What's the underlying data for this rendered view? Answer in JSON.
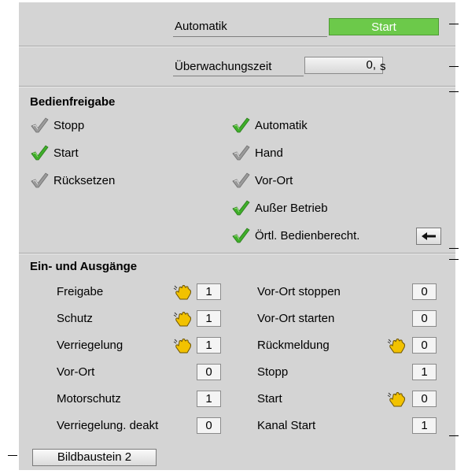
{
  "header": {
    "automatik_label": "Automatik",
    "start_button": "Start",
    "watch_label": "Überwachungszeit",
    "watch_value": "0,",
    "watch_unit": "s"
  },
  "permissions": {
    "title": "Bedienfreigabe",
    "left": [
      {
        "label": "Stopp",
        "enabled": false
      },
      {
        "label": "Start",
        "enabled": true
      },
      {
        "label": "Rücksetzen",
        "enabled": false
      }
    ],
    "right": [
      {
        "label": "Automatik",
        "enabled": true
      },
      {
        "label": "Hand",
        "enabled": false
      },
      {
        "label": "Vor-Ort",
        "enabled": false
      },
      {
        "label": "Außer Betrieb",
        "enabled": true
      },
      {
        "label": "Örtl. Bedienberecht.",
        "enabled": true
      }
    ]
  },
  "io": {
    "title": "Ein- und Ausgänge",
    "left": [
      {
        "label": "Freigabe",
        "value": "1",
        "hand": true
      },
      {
        "label": "Schutz",
        "value": "1",
        "hand": true
      },
      {
        "label": "Verriegelung",
        "value": "1",
        "hand": true
      },
      {
        "label": "Vor-Ort",
        "value": "0",
        "hand": false
      },
      {
        "label": "Motorschutz",
        "value": "1",
        "hand": false
      },
      {
        "label": "Verriegelung. deakt",
        "value": "0",
        "hand": false
      }
    ],
    "right": [
      {
        "label": "Vor-Ort stoppen",
        "value": "0",
        "hand": false
      },
      {
        "label": "Vor-Ort starten",
        "value": "0",
        "hand": false
      },
      {
        "label": "Rückmeldung",
        "value": "0",
        "hand": true
      },
      {
        "label": "Stopp",
        "value": "1",
        "hand": false
      },
      {
        "label": "Start",
        "value": "0",
        "hand": true
      },
      {
        "label": "Kanal Start",
        "value": "1",
        "hand": false
      }
    ]
  },
  "footer": {
    "bildbaustein_button": "Bildbaustein 2"
  },
  "colors": {
    "panel": "#d4d4d4",
    "start_green": "#6cc94a",
    "check_green": "#3fae2a",
    "check_gray": "#9a9a9a",
    "hand_yellow": "#f2c200"
  }
}
